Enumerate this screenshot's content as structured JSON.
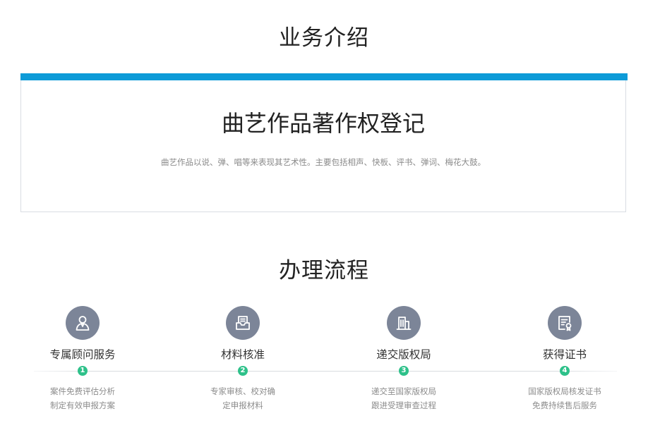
{
  "intro": {
    "section_title": "业务介绍",
    "card_title": "曲艺作品著作权登记",
    "card_desc": "曲艺作品以说、弹、唱等来表现其艺术性。主要包括相声、快板、评书、弹词、梅花大鼓。",
    "accent_color": "#0d9bd8"
  },
  "process": {
    "section_title": "办理流程",
    "step_color": "#2ec18a",
    "icon_color": "#7c8598",
    "steps": [
      {
        "icon": "consultant-icon",
        "title": "专属顾问服务",
        "num": "1",
        "line1": "案件免费评估分析",
        "line2": "制定有效申报方案"
      },
      {
        "icon": "document-tray-icon",
        "title": "材料核准",
        "num": "2",
        "line1": "专家审核、校对确",
        "line2": "定申报材料"
      },
      {
        "icon": "building-icon",
        "title": "递交版权局",
        "num": "3",
        "line1": "递交至国家版权局",
        "line2": "跟进受理审查过程"
      },
      {
        "icon": "certificate-icon",
        "title": "获得证书",
        "num": "4",
        "line1": "国家版权局核发证书",
        "line2": "免费持续售后服务"
      }
    ]
  }
}
